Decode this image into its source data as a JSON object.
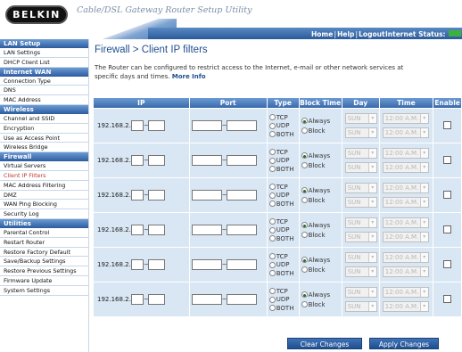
{
  "header": {
    "logo_text": "BELKIN",
    "app_title": "Cable/DSL Gateway Router Setup Utility",
    "nav": [
      {
        "label": "Home"
      },
      {
        "label": "Help"
      },
      {
        "label": "Logout"
      }
    ],
    "internet_status_label": "Internet Status:",
    "internet_status_color": "#3cb043"
  },
  "sidebar": {
    "sections": [
      {
        "title": "LAN Setup",
        "items": [
          "LAN Settings",
          "DHCP Client List"
        ]
      },
      {
        "title": "Internet WAN",
        "items": [
          "Connection Type",
          "DNS",
          "MAC Address"
        ]
      },
      {
        "title": "Wireless",
        "items": [
          "Channel and SSID",
          "Encryption",
          "Use as Access Point",
          "Wireless Bridge"
        ]
      },
      {
        "title": "Firewall",
        "items": [
          "Virtual Servers",
          "Client IP Filters",
          "MAC Address Filtering",
          "DMZ",
          "WAN Ping Blocking",
          "Security Log"
        ]
      },
      {
        "title": "Utilities",
        "items": [
          "Parental Control",
          "Restart Router",
          "Restore Factory Default",
          "Save/Backup Settings",
          "Restore Previous Settings",
          "Firmware Update",
          "System Settings"
        ]
      }
    ],
    "active_item": "Client IP Filters"
  },
  "main": {
    "title": "Firewall > Client IP filters",
    "description": "The Router can be configured to restrict access to the Internet, e-mail or other network services at specific days and times.",
    "more_info": "More Info",
    "columns": [
      "IP",
      "Port",
      "Type",
      "Block Time",
      "Day",
      "Time",
      "Enable"
    ],
    "ip_prefix": "192.168.2.",
    "type_options": [
      "TCP",
      "UDP",
      "BOTH"
    ],
    "block_options": [
      "Always",
      "Block"
    ],
    "day_value": "SUN",
    "time_value": "12:00 A.M.",
    "rows": [
      {
        "block": "Always",
        "enabled": false
      },
      {
        "block": "Always",
        "enabled": false
      },
      {
        "block": "Always",
        "enabled": false
      },
      {
        "block": "Always",
        "enabled": false
      },
      {
        "block": "Always",
        "enabled": false
      },
      {
        "block": "Always",
        "enabled": false
      }
    ]
  },
  "buttons": {
    "clear": "Clear Changes",
    "apply": "Apply Changes"
  },
  "colors": {
    "accent": "#1f4f8f",
    "header_blue": "#2c5c9e",
    "row_bg": "#d9e6f4",
    "active_link": "#c0392b"
  }
}
